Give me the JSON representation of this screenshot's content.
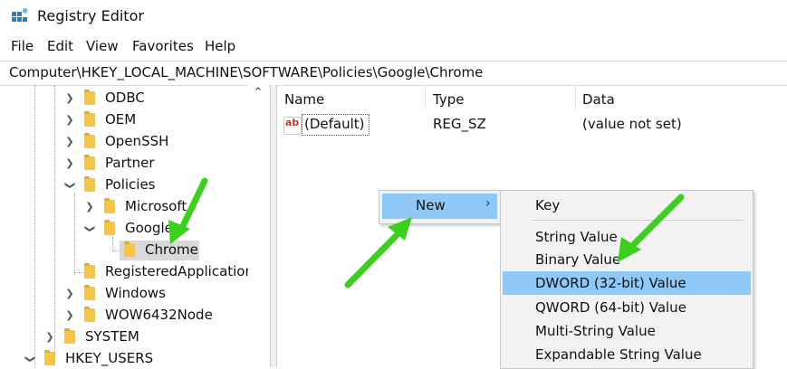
{
  "window": {
    "title": "Registry Editor",
    "icon": "registry-editor-icon"
  },
  "menu": {
    "items": [
      "File",
      "Edit",
      "View",
      "Favorites",
      "Help"
    ]
  },
  "address": {
    "path": "Computer\\HKEY_LOCAL_MACHINE\\SOFTWARE\\Policies\\Google\\Chrome"
  },
  "tree": {
    "items": [
      {
        "label": "ODBC",
        "state": "collapsed"
      },
      {
        "label": "OEM",
        "state": "collapsed"
      },
      {
        "label": "OpenSSH",
        "state": "collapsed"
      },
      {
        "label": "Partner",
        "state": "collapsed"
      },
      {
        "label": "Policies",
        "state": "expanded"
      },
      {
        "label": "Microsoft",
        "state": "collapsed"
      },
      {
        "label": "Google",
        "state": "expanded"
      },
      {
        "label": "Chrome",
        "state": "selected"
      },
      {
        "label": "RegisteredApplications",
        "state": "leaf"
      },
      {
        "label": "Windows",
        "state": "collapsed"
      },
      {
        "label": "WOW6432Node",
        "state": "collapsed"
      },
      {
        "label": "SYSTEM",
        "state": "collapsed"
      },
      {
        "label": "HKEY_USERS",
        "state": "expanded"
      }
    ]
  },
  "list": {
    "columns": [
      "Name",
      "Type",
      "Data"
    ],
    "rows": [
      {
        "name": "(Default)",
        "type": "REG_SZ",
        "data": "(value not set)",
        "icon": "string-value-icon"
      }
    ]
  },
  "context_menu": {
    "new_label": "New"
  },
  "submenu": {
    "items": [
      "Key",
      "String Value",
      "Binary Value",
      "DWORD (32-bit) Value",
      "QWORD (64-bit) Value",
      "Multi-String Value",
      "Expandable String Value"
    ],
    "highlighted": "DWORD (32-bit) Value"
  },
  "colors": {
    "highlight": "#90c8f6",
    "annotation_arrow": "#3ccf1e",
    "folder": "#f4c44b"
  }
}
